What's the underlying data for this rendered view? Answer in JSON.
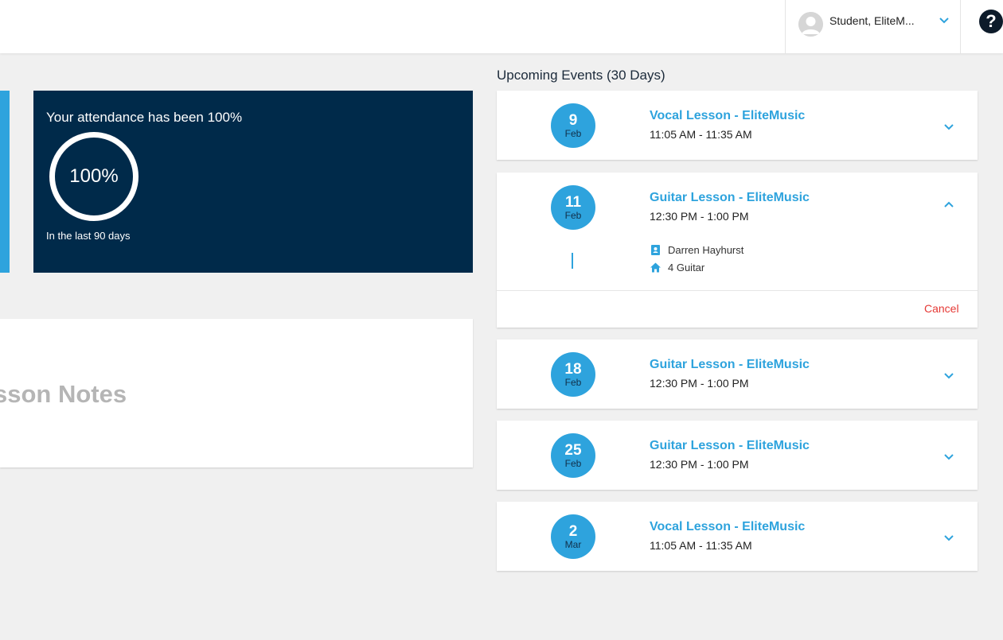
{
  "header": {
    "user_name": "Student, EliteM...",
    "help_label": "?"
  },
  "attendance": {
    "title": "Your attendance has been 100%",
    "value": "100%",
    "subtitle": "In the last 90 days"
  },
  "notes": {
    "title": "sson Notes"
  },
  "events": {
    "heading": "Upcoming Events (30 Days)",
    "items": [
      {
        "day": "9",
        "month": "Feb",
        "title": "Vocal Lesson - EliteMusic",
        "time": "11:05 AM - 11:35 AM",
        "expanded": false
      },
      {
        "day": "11",
        "month": "Feb",
        "title": "Guitar Lesson - EliteMusic",
        "time": "12:30 PM - 1:00 PM",
        "expanded": true,
        "teacher": "Darren Hayhurst",
        "room": "4 Guitar",
        "cancel_label": "Cancel"
      },
      {
        "day": "18",
        "month": "Feb",
        "title": "Guitar Lesson - EliteMusic",
        "time": "12:30 PM - 1:00 PM",
        "expanded": false
      },
      {
        "day": "25",
        "month": "Feb",
        "title": "Guitar Lesson - EliteMusic",
        "time": "12:30 PM - 1:00 PM",
        "expanded": false
      },
      {
        "day": "2",
        "month": "Mar",
        "title": "Vocal Lesson - EliteMusic",
        "time": "11:05 AM - 11:35 AM",
        "expanded": false
      }
    ]
  },
  "colors": {
    "accent": "#2ea3dd",
    "navy": "#002a4a",
    "cancel": "#e53935",
    "background": "#f0f0f0"
  },
  "icons": {
    "user_avatar": "user-avatar-icon",
    "expand": "chevron-down-icon",
    "collapse": "chevron-up-icon",
    "teacher": "contact-card-icon",
    "room": "home-icon",
    "help": "help-icon"
  }
}
